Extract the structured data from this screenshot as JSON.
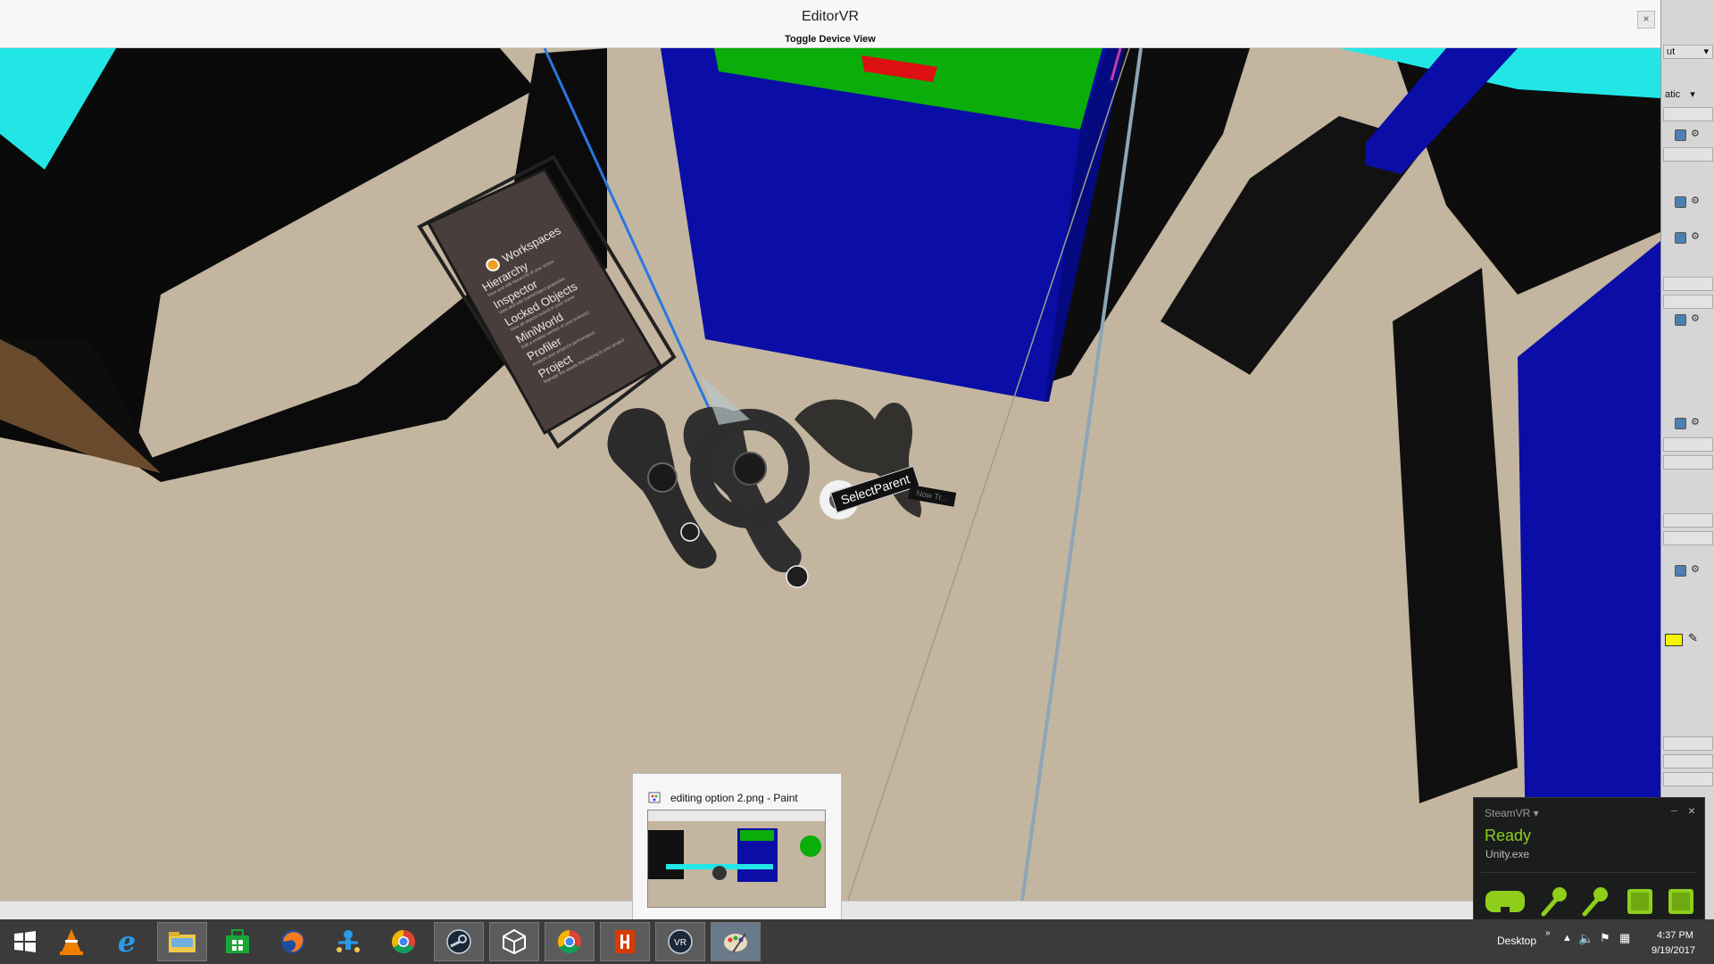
{
  "window": {
    "title": "EditorVR",
    "subtitle": "Toggle Device View",
    "close_glyph": "×"
  },
  "workspaces": {
    "header": "Workspaces",
    "items": [
      {
        "label": "Hierarchy",
        "desc": "View and edit hierarchy of your scene"
      },
      {
        "label": "Inspector",
        "desc": "View and edit GameObject properties"
      },
      {
        "label": "Locked Objects",
        "desc": "View all objects locked in your scene"
      },
      {
        "label": "MiniWorld",
        "desc": "Edit a smaller version of your scene(s)"
      },
      {
        "label": "Profiler",
        "desc": "Analyze your project's performance"
      },
      {
        "label": "Project",
        "desc": "Manage the assets that belong to your project"
      }
    ]
  },
  "tooltip": {
    "primary": "SelectParent",
    "secondary": "Now Tr..."
  },
  "inspector": {
    "dropdown1": "ut",
    "dropdown2": "atic"
  },
  "thumbnail": {
    "label": "editing option 2.png - Paint"
  },
  "steamvr": {
    "header": "SteamVR ▾",
    "status": "Ready",
    "app": "Unity.exe",
    "minimize": "–",
    "close": "×"
  },
  "taskbar": {
    "apps": [
      "Start",
      "VLC",
      "Internet Explorer",
      "File Explorer",
      "Store",
      "Firefox",
      "Network",
      "Chrome",
      "Steam",
      "Unity",
      "Chrome",
      "Office",
      "SteamVR",
      "Paint"
    ],
    "tray_label": "Desktop",
    "tray_chevron": "»",
    "time": "4:37 PM",
    "date": "9/19/2017"
  },
  "colors": {
    "floor": "#c4b5a0",
    "blue": "#0a0ea6",
    "green": "#0aad0a",
    "cyan": "#22e6e6",
    "steam_green": "#8fce1a"
  }
}
